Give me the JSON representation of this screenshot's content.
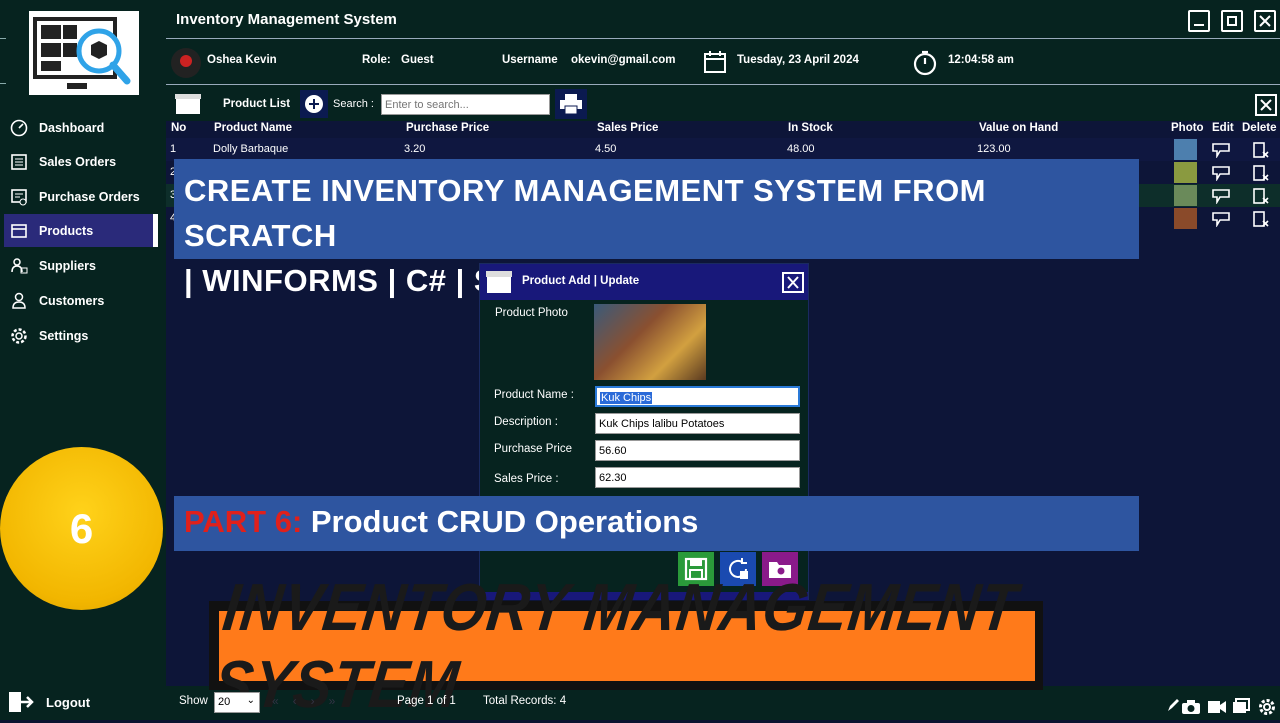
{
  "app": {
    "title": "Inventory Management System"
  },
  "user": {
    "name": "Oshea Kevin",
    "role_label": "Role:",
    "role": "Guest",
    "username_label": "Username",
    "username": "okevin@gmail.com",
    "date": "Tuesday, 23 April 2024",
    "time": "12:04:58 am"
  },
  "sidebar": {
    "items": [
      {
        "label": "Dashboard",
        "icon": "dashboard-icon"
      },
      {
        "label": "Sales Orders",
        "icon": "sales-orders-icon"
      },
      {
        "label": "Purchase Orders",
        "icon": "purchase-orders-icon"
      },
      {
        "label": "Products",
        "icon": "products-icon"
      },
      {
        "label": "Suppliers",
        "icon": "suppliers-icon"
      },
      {
        "label": "Customers",
        "icon": "customers-icon"
      },
      {
        "label": "Settings",
        "icon": "settings-icon"
      }
    ],
    "active": "Products",
    "logout": "Logout"
  },
  "toolbar": {
    "title": "Product List",
    "search_label": "Search :",
    "search_placeholder": "Enter to search..."
  },
  "table": {
    "columns": [
      "No",
      "Product Name",
      "Purchase Price",
      "Sales Price",
      "In Stock",
      "Value on Hand",
      "Photo",
      "Edit",
      "Delete"
    ],
    "rows": [
      {
        "no": "1",
        "name": "Dolly Barbaque",
        "purchase": "3.20",
        "sales": "4.50",
        "stock": "48.00",
        "value": "123.00"
      },
      {
        "no": "2"
      },
      {
        "no": "3"
      },
      {
        "no": "4"
      }
    ]
  },
  "banner": {
    "line1": "CREATE INVENTORY MANAGEMENT SYSTEM FROM SCRATCH",
    "line2": "| WINFORMS | C# | SQL SERVER"
  },
  "dialog": {
    "title": "Product Add | Update",
    "photo_label": "Product Photo",
    "name_label": "Product Name :",
    "name_value": "Kuk Chips",
    "desc_label": "Description :",
    "desc_value": "Kuk Chips lalibu Potatoes",
    "purchase_label": "Purchase Price",
    "purchase_value": "56.60",
    "sales_label": "Sales Price :",
    "sales_value": "62.30"
  },
  "part": {
    "prefix": "PART 6:",
    "text": " Product CRUD Operations"
  },
  "episode": "6",
  "headline": "INVENTORY MANAGEMENT SYSTEM",
  "footer": {
    "show_label": "Show",
    "page_size": "20",
    "page_info": "Page 1 of 1",
    "total": "Total Records: 4"
  },
  "colors": {
    "sidebar_bg": "#06231f",
    "active_nav": "#2a2a7a",
    "banner": "#2e55a0",
    "accent_red": "#e0201b",
    "orange": "#ff7a1a"
  }
}
